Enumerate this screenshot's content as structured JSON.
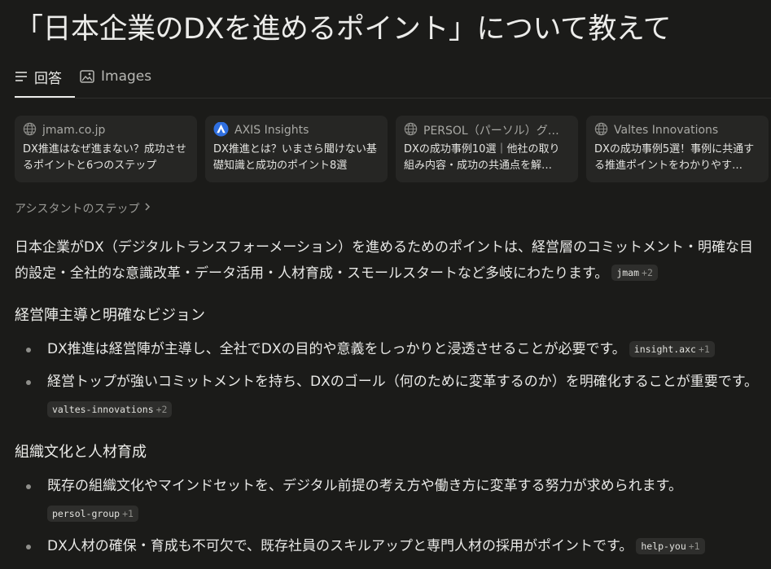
{
  "page": {
    "title": "「日本企業のDXを進めるポイント」について教えて"
  },
  "tabs": [
    {
      "label": "回答",
      "icon": "list-icon",
      "active": true
    },
    {
      "label": "Images",
      "icon": "image-icon",
      "active": false
    }
  ],
  "sources": [
    {
      "site": "jmam.co.jp",
      "icon": "globe-icon",
      "snippet": "DX推進はなぜ進まない？成功させるポイントと6つのステップ"
    },
    {
      "site": "AXIS Insights",
      "icon": "axis-logo-icon",
      "snippet": "DX推進とは？いまさら聞けない基礎知識と成功のポイント8選"
    },
    {
      "site": "PERSOL（パーソル）グル…",
      "icon": "globe-icon",
      "snippet": "DXの成功事例10選｜他社の取り組み内容・成功の共通点を解…"
    },
    {
      "site": "Valtes Innovations",
      "icon": "globe-icon",
      "snippet": "DXの成功事例5選！事例に共通する推進ポイントをわかりやす…"
    }
  ],
  "steps_label": "アシスタントのステップ",
  "answer": {
    "intro": "日本企業がDX（デジタルトランスフォーメーション）を進めるためのポイントは、経営層のコミットメント・明確な目的設定・全社的な意識改革・データ活用・人材育成・スモールスタートなど多岐にわたります。",
    "intro_cite": {
      "source": "jmam",
      "more": "+2"
    },
    "sections": [
      {
        "heading": "経営陣主導と明確なビジョン",
        "items": [
          {
            "text": "DX推進は経営陣が主導し、全社でDXの目的や意義をしっかりと浸透させることが必要です。",
            "cite": "insight.axc",
            "more": "+1"
          },
          {
            "text": "経営トップが強いコミットメントを持ち、DXのゴール（何のために変革するのか）を明確化することが重要です。",
            "cite": "valtes-innovations",
            "more": "+2"
          }
        ]
      },
      {
        "heading": "組織文化と人材育成",
        "items": [
          {
            "text": "既存の組織文化やマインドセットを、デジタル前提の考え方や働き方に変革する努力が求められます。",
            "cite": "persol-group",
            "more": "+1"
          },
          {
            "text": "DX人材の確保・育成も不可欠で、既存社員のスキルアップと専門人材の採用がポイントです。",
            "cite": "help-you",
            "more": "+1"
          }
        ]
      }
    ]
  }
}
